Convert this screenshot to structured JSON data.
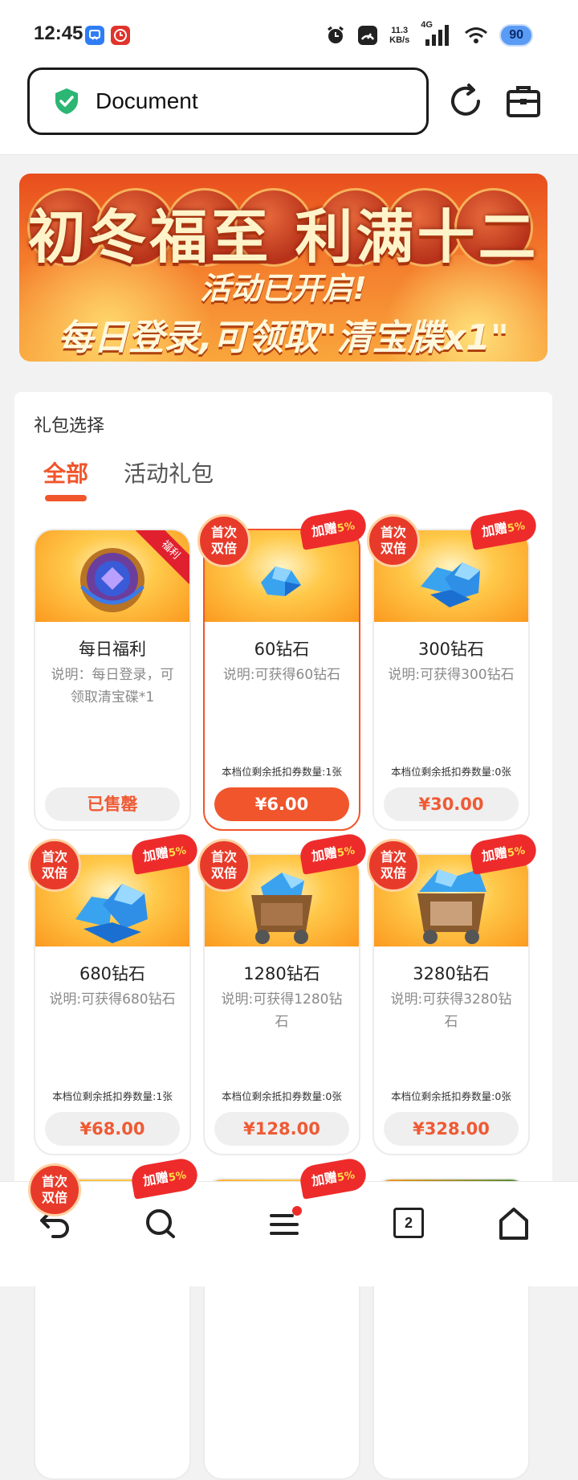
{
  "status_bar": {
    "time": "12:45",
    "net_speed_value": "11.3",
    "net_speed_unit": "KB/s",
    "network_type": "4G",
    "battery": "90"
  },
  "address_bar": {
    "url_text": "Document",
    "secure_icon": "shield-check-icon",
    "reload_icon": "reload-icon",
    "toolbox_icon": "briefcase-icon"
  },
  "banner": {
    "title": "初冬福至 利满十二",
    "line1": "活动已开启!",
    "line2": "每日登录,可领取\"清宝牒x1\""
  },
  "gift_panel": {
    "title": "礼包选择",
    "tabs": [
      {
        "label": "全部",
        "active": true
      },
      {
        "label": "活动礼包",
        "active": false
      }
    ],
    "first_badge": "首次双倍",
    "bonus_label": "加赠",
    "bonus_pct": "5%",
    "welfare_ribbon": "福利",
    "cards": [
      {
        "name": "每日福利",
        "desc": "说明：每日登录，可领取清宝碟*1",
        "coupon": "",
        "price": "已售罄",
        "sold_out": true,
        "selected": false
      },
      {
        "name": "60钻石",
        "desc": "说明:可获得60钻石",
        "coupon": "本档位剩余抵扣券数量:1张",
        "price": "¥6.00",
        "sold_out": false,
        "selected": true
      },
      {
        "name": "300钻石",
        "desc": "说明:可获得300钻石",
        "coupon": "本档位剩余抵扣券数量:0张",
        "price": "¥30.00",
        "sold_out": false,
        "selected": false
      },
      {
        "name": "680钻石",
        "desc": "说明:可获得680钻石",
        "coupon": "本档位剩余抵扣券数量:1张",
        "price": "¥68.00",
        "sold_out": false,
        "selected": false
      },
      {
        "name": "1280钻石",
        "desc": "说明:可获得1280钻石",
        "coupon": "本档位剩余抵扣券数量:0张",
        "price": "¥128.00",
        "sold_out": false,
        "selected": false
      },
      {
        "name": "3280钻石",
        "desc": "说明:可获得3280钻石",
        "coupon": "本档位剩余抵扣券数量:0张",
        "price": "¥328.00",
        "sold_out": false,
        "selected": false
      }
    ]
  },
  "bottom_nav": {
    "tab_count": "2",
    "items": [
      "back-icon",
      "search-icon",
      "menu-icon",
      "tabs-icon",
      "home-icon"
    ]
  },
  "colors": {
    "accent": "#f0552b",
    "badge_red": "#e83a2a"
  }
}
